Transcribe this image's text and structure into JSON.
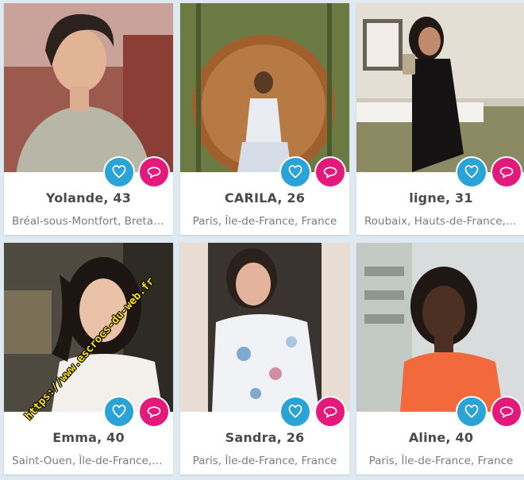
{
  "profiles": [
    {
      "name": "Yolande, 43",
      "location": "Bréal-sous-Montfort, Bretag..."
    },
    {
      "name": "CARILA, 26",
      "location": "Paris, Île-de-France, France"
    },
    {
      "name": "ligne, 31",
      "location": "Roubaix, Hauts-de-France, F..."
    },
    {
      "name": "Emma, 40",
      "location": "Saint-Ouen, Île-de-France, F..."
    },
    {
      "name": "Sandra, 26",
      "location": "Paris, Île-de-France, France"
    },
    {
      "name": "Aline, 40",
      "location": "Paris, Île-de-France, France"
    }
  ],
  "watermark": "https://www.escrocs-du-web.fr",
  "icons": {
    "like": "heart-icon",
    "message": "chat-bubble-icon"
  },
  "colors": {
    "like": "#2aa3d6",
    "message": "#e3197b",
    "background": "#dfe9f1"
  }
}
